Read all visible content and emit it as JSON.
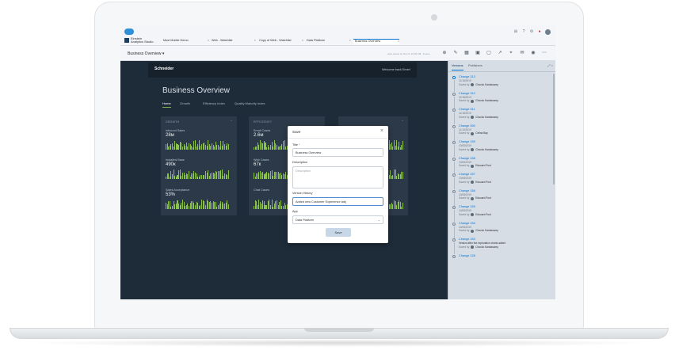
{
  "app": {
    "name_line1": "Einstein",
    "name_line2": "Analytics Studio"
  },
  "tabs": [
    {
      "label": "Most Mobile Demo"
    },
    {
      "label": "Web - Watchlist"
    },
    {
      "label": "Copy of Web - Watchlist"
    },
    {
      "label": "Data Platform"
    },
    {
      "label": "Business Overview"
    }
  ],
  "toolbar": {
    "title": "Business Overview ▾",
    "save_note": "Auto saved on Nov 8, 10:38 AM · 8 secs"
  },
  "dashboard": {
    "brand": "Schneider",
    "welcome": "Welcome back Emer!",
    "heading": "Business Overview",
    "nav": [
      "Home",
      "Growth",
      "Efficiency Index",
      "Quality Maturity Index"
    ],
    "panels": [
      {
        "title": "GROWTH",
        "metrics": [
          {
            "label": "Inbound Sales",
            "value": "28м"
          },
          {
            "label": "Installed Base",
            "value": "490к"
          },
          {
            "label": "Sales Acceptance",
            "value": "53%"
          }
        ]
      },
      {
        "title": "EFFICIENCY",
        "metrics": [
          {
            "label": "Email Cases",
            "value": "2.6м"
          },
          {
            "label": "Web Cases",
            "value": "67к"
          },
          {
            "label": "Chat Cases",
            "value": ""
          }
        ]
      }
    ]
  },
  "modal": {
    "title": "Save",
    "title_label": "Title",
    "title_value": "Business Overview",
    "description_label": "Description",
    "description_placeholder": "Description",
    "version_label": "Version History",
    "version_value": "Added new Customer Experience tab|",
    "app_label": "App",
    "app_value": "Data Platform",
    "save_label": "Save"
  },
  "right_panel": {
    "tabs": [
      "Versions",
      "Publishers"
    ],
    "versions": [
      {
        "name": "Change 313",
        "date": "11/18/2019",
        "by": "Chocko Kandasamy"
      },
      {
        "name": "Change 312",
        "date": "11/18/2019",
        "by": "Chocko Kandasamy"
      },
      {
        "name": "Change 311",
        "date": "11/18/2019",
        "by": "Chocko Kandasamy"
      },
      {
        "name": "Change 260",
        "date": "11/10/2019",
        "by": "Celina Bay"
      },
      {
        "name": "Change 159",
        "date": "10/08/2019",
        "by": "Chocko Kandasamy"
      },
      {
        "name": "Change 158",
        "date": "10/08/2019",
        "by": "Edouard Poot"
      },
      {
        "name": "Change 157",
        "date": "10/08/2019",
        "by": "Edouard Poot"
      },
      {
        "name": "Change 156",
        "date": "10/08/2019",
        "by": "Edouard Poot"
      },
      {
        "name": "Change 155",
        "date": "10/08/2019",
        "by": "Edouard Poot"
      },
      {
        "name": "Change 154",
        "date": "10/08/2019",
        "by": "Chocko Kandasamy"
      },
      {
        "name": "Change 153",
        "date": "",
        "note": "Version after the exploration charts added",
        "by": "Chocko Kandasamy"
      },
      {
        "name": "Change 128",
        "date": "",
        "by": ""
      }
    ],
    "saved_by_label": "Saved by"
  }
}
